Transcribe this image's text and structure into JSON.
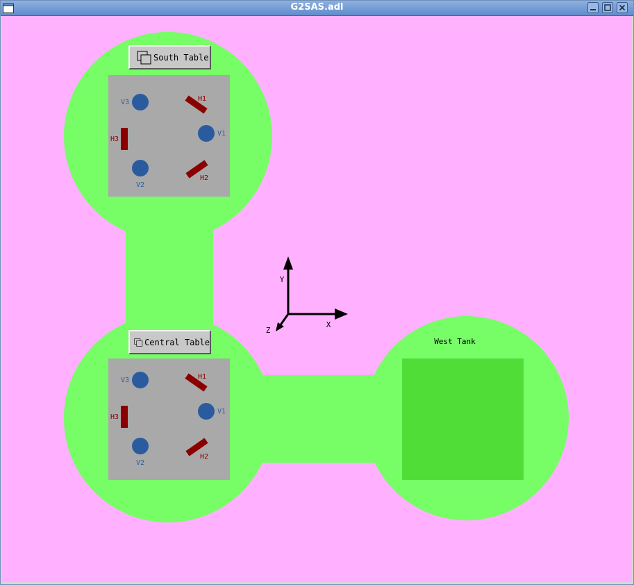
{
  "window": {
    "title": "G2SAS.adl"
  },
  "colors": {
    "background": "#ffb1ff",
    "tank": "#77fd66",
    "tank_floor": "#50dd38",
    "table": "#a9a9a9",
    "vertical_jack": "#2a5b9f",
    "horizontal_jack": "#8a0000",
    "axes": "#000000"
  },
  "south_table": {
    "button_label": "South Table",
    "labels": {
      "v3": "V3",
      "h1": "H1",
      "h3": "H3",
      "v1": "V1",
      "v2": "V2",
      "h2": "H2"
    }
  },
  "central_table": {
    "button_label": "Central Table",
    "labels": {
      "v3": "V3",
      "h1": "H1",
      "h3": "H3",
      "v1": "V1",
      "v2": "V2",
      "h2": "H2"
    }
  },
  "west_tank": {
    "label": "West Tank"
  },
  "axes": {
    "x_label": "X",
    "y_label": "Y",
    "z_label": "Z"
  }
}
